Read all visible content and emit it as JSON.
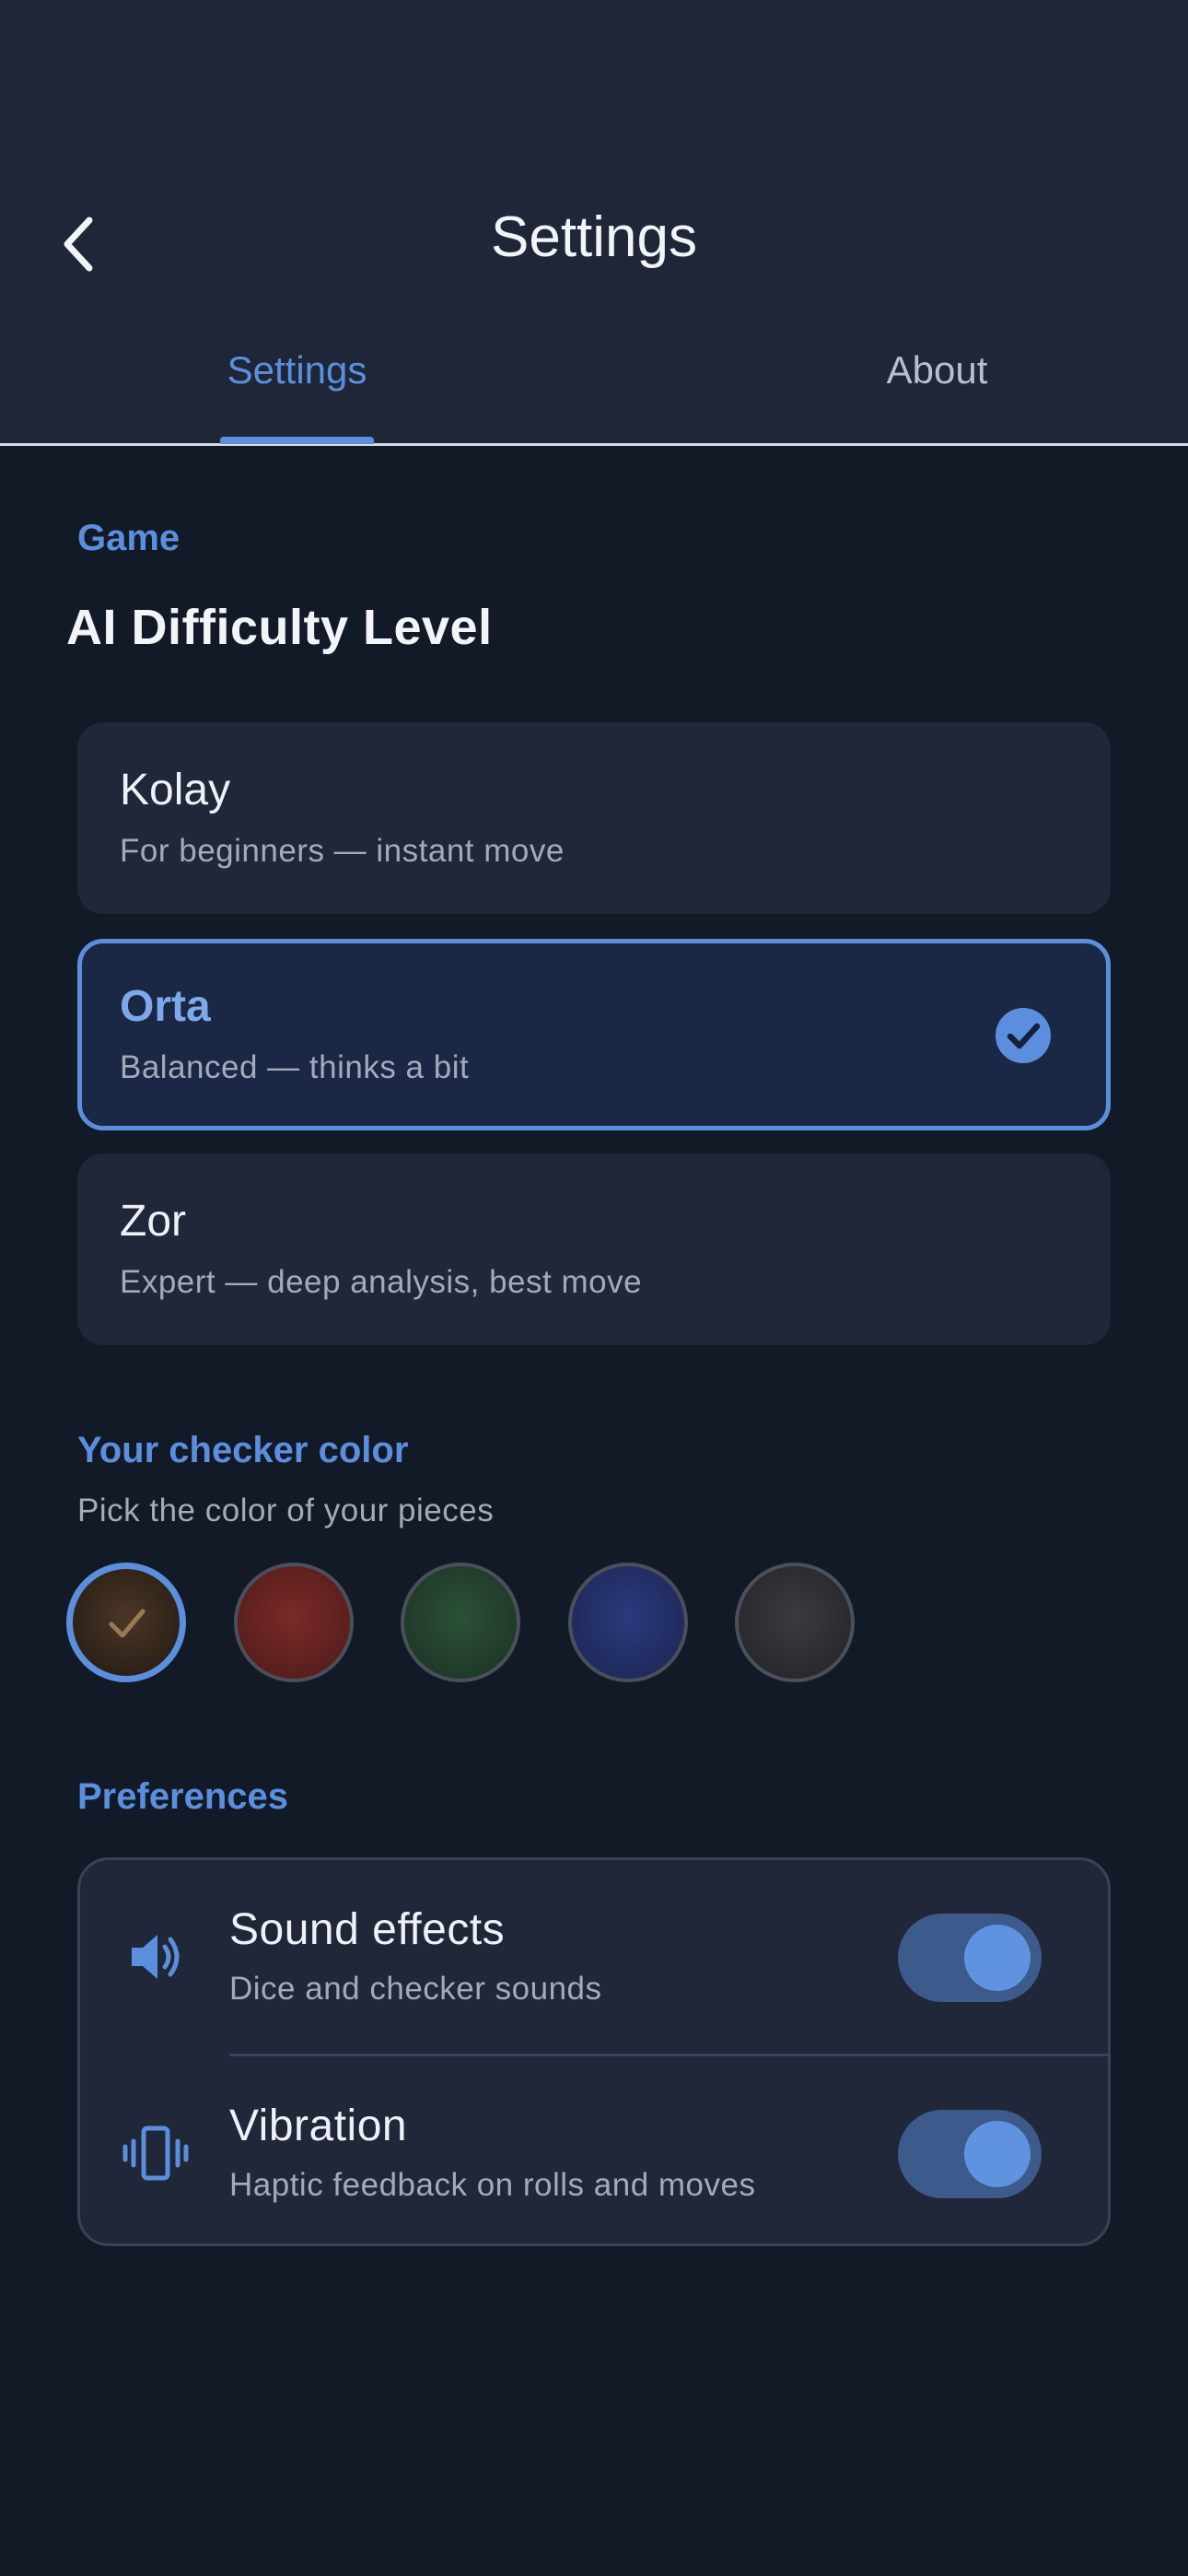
{
  "header": {
    "title": "Settings",
    "tabs": [
      {
        "label": "Settings",
        "active": true
      },
      {
        "label": "About",
        "active": false
      }
    ]
  },
  "game": {
    "section_label": "Game",
    "heading": "AI Difficulty Level",
    "options": [
      {
        "title": "Kolay",
        "subtitle": "For beginners — instant move",
        "selected": false
      },
      {
        "title": "Orta",
        "subtitle": "Balanced — thinks a bit",
        "selected": true
      },
      {
        "title": "Zor",
        "subtitle": "Expert — deep analysis, best move",
        "selected": false
      }
    ]
  },
  "checker_color": {
    "section_label": "Your checker color",
    "subtitle": "Pick the color of your pieces",
    "swatches": [
      {
        "color": "#3a2a1c",
        "selected": true
      },
      {
        "color": "#5a1f1f",
        "selected": false
      },
      {
        "color": "#1f3b29",
        "selected": false
      },
      {
        "color": "#1e2a5c",
        "selected": false
      },
      {
        "color": "#2c2c30",
        "selected": false
      }
    ]
  },
  "preferences": {
    "section_label": "Preferences",
    "items": [
      {
        "icon": "speaker-icon",
        "title": "Sound effects",
        "subtitle": "Dice and checker sounds",
        "enabled": true
      },
      {
        "icon": "vibration-icon",
        "title": "Vibration",
        "subtitle": "Haptic feedback on rolls and moves",
        "enabled": true
      }
    ]
  },
  "colors": {
    "accent": "#5b8fde",
    "background": "#121a28",
    "surface": "#1f2738",
    "header": "#1e2637"
  }
}
